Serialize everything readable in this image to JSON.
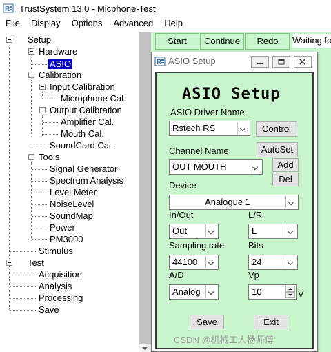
{
  "window": {
    "title": "TrustSystem 13.0 - Micphone-Test",
    "icon": "app-logo-icon"
  },
  "menu": {
    "items": [
      "File",
      "Display",
      "Options",
      "Advanced",
      "Help"
    ]
  },
  "tree": {
    "setup": "Setup",
    "hardware": "Hardware",
    "asio": "ASIO",
    "calibration": "Calibration",
    "input_calibration": "Input Calibration",
    "microphone_cal": "Microphone Cal.",
    "output_calibration": "Output Calibration",
    "amplifier_cal": "Amplifier Cal.",
    "mouth_cal": "Mouth Cal.",
    "soundcard_cal": "SoundCard Cal.",
    "tools": "Tools",
    "signal_generator": "Signal Generator",
    "spectrum_analysis": "Spectrum Analysis",
    "level_meter": "Level Meter",
    "noise_level": "NoiseLevel",
    "sound_map": "SoundMap",
    "power": "Power",
    "pm3000": "PM3000",
    "stimulus": "Stimulus",
    "test": "Test",
    "acquisition": "Acquisition",
    "analysis": "Analysis",
    "processing": "Processing",
    "save": "Save"
  },
  "toolbar": {
    "start": "Start",
    "continue": "Continue",
    "redo": "Redo",
    "status": "Waiting fo"
  },
  "dialog": {
    "title": "ASIO Setup",
    "heading": "ASIO  Setup",
    "driver_label": "ASIO Driver Name",
    "driver_value": "Rstech RS",
    "control_button": "Control",
    "channel_label": "Channel Name",
    "autoset_button": "AutoSet",
    "channel_value": "OUT MOUTH",
    "add_button": "Add",
    "del_button": "Del",
    "device_label": "Device",
    "device_value": "Analogue 1",
    "inout_label": "In/Out",
    "inout_value": "Out",
    "lr_label": "L/R",
    "lr_value": "L",
    "sampling_label": "Sampling rate",
    "sampling_value": "44100",
    "bits_label": "Bits",
    "bits_value": "24",
    "ad_label": "A/D",
    "ad_value": "Analog",
    "vp_label": "Vp",
    "vp_value": "10",
    "vp_unit": "V",
    "save_button": "Save",
    "exit_button": "Exit"
  },
  "watermark": "CSDN @机械工人杨师傅",
  "colors": {
    "panel_green": "#c9f5cc",
    "selection_blue": "#0000cc"
  }
}
